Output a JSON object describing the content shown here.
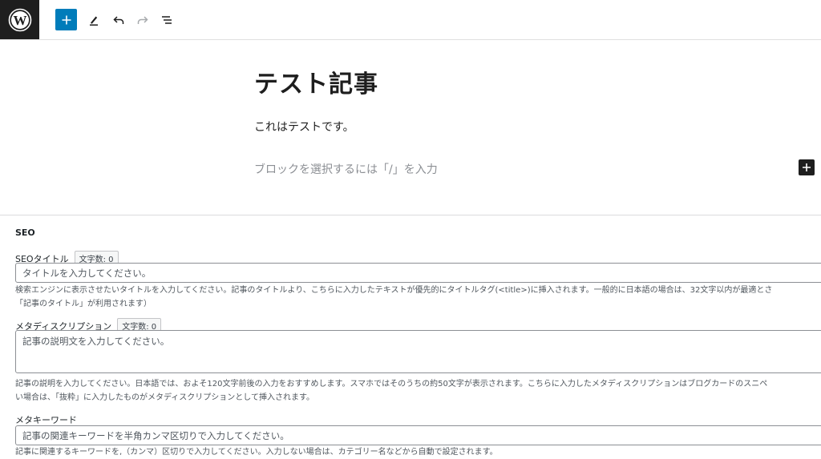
{
  "toolbar": {
    "logo_icon": "wordpress-logo-icon",
    "add_icon": "plus-icon",
    "tools_icon": "pencil-icon",
    "undo_icon": "undo-icon",
    "redo_icon": "redo-icon",
    "list_view_icon": "list-view-icon",
    "accent_color": "#007cba"
  },
  "editor": {
    "title": "テスト記事",
    "paragraph": "これはテストです。",
    "block_placeholder": "ブロックを選択するには「/」を入力",
    "inserter_icon": "plus-icon"
  },
  "seo": {
    "heading": "SEO",
    "seo_title": {
      "label": "SEOタイトル",
      "count": "文字数: 0",
      "placeholder": "タイトルを入力してください。",
      "help_line1": "検索エンジンに表示させたいタイトルを入力してください。記事のタイトルより、こちらに入力したテキストが優先的にタイトルタグ(<title>)に挿入されます。一般的に日本語の場合は、32文字以内が最適とさ",
      "help_line2": "「記事のタイトル」が利用されます）"
    },
    "meta_description": {
      "label": "メタディスクリプション",
      "count": "文字数: 0",
      "placeholder": "記事の説明文を入力してください。",
      "help_line1": "記事の説明を入力してください。日本語では、およそ120文字前後の入力をおすすめします。スマホではそのうちの約50文字が表示されます。こちらに入力したメタディスクリプションはブログカードのスニペ",
      "help_line2": "い場合は、「抜粋」に入力したものがメタディスクリプションとして挿入されます。"
    },
    "meta_keywords": {
      "label": "メタキーワード",
      "placeholder": "記事の関連キーワードを半角カンマ区切りで入力してください。",
      "help_line1": "記事に関連するキーワードを,（カンマ）区切りで入力してください。入力しない場合は、カテゴリー名などから自動で設定されます。"
    }
  }
}
